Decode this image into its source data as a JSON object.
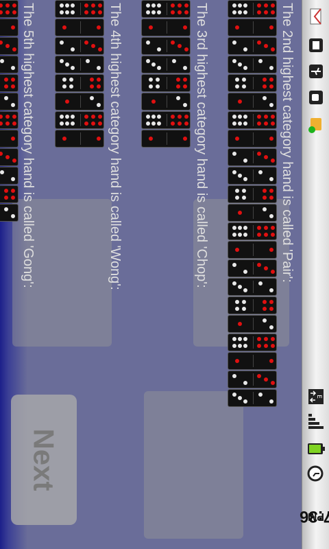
{
  "statusbar": {
    "time": "7:36",
    "time_suffix": "PM",
    "icons": [
      "gmail-icon",
      "sim-toolkit-icon",
      "usb-icon",
      "android-debug-icon",
      "market-update-icon",
      "data-arrows-icon",
      "signal-icon",
      "battery-icon",
      "alarm-icon"
    ],
    "network_label": "E"
  },
  "hands": {
    "pair": "The 2nd highest category hand is called 'Pair':",
    "chop": "The 3rd highest category hand is called 'Chop':",
    "wong": "The 4th highest category hand is called 'Wong':",
    "gong": "The 5th highest category hand is called 'Gong':"
  },
  "next_button": {
    "label": "Next"
  },
  "colors": {
    "background": "#6a6d99",
    "tile": "#111111",
    "pip_red": "#e01010",
    "pip_white": "#e8e8e8"
  }
}
